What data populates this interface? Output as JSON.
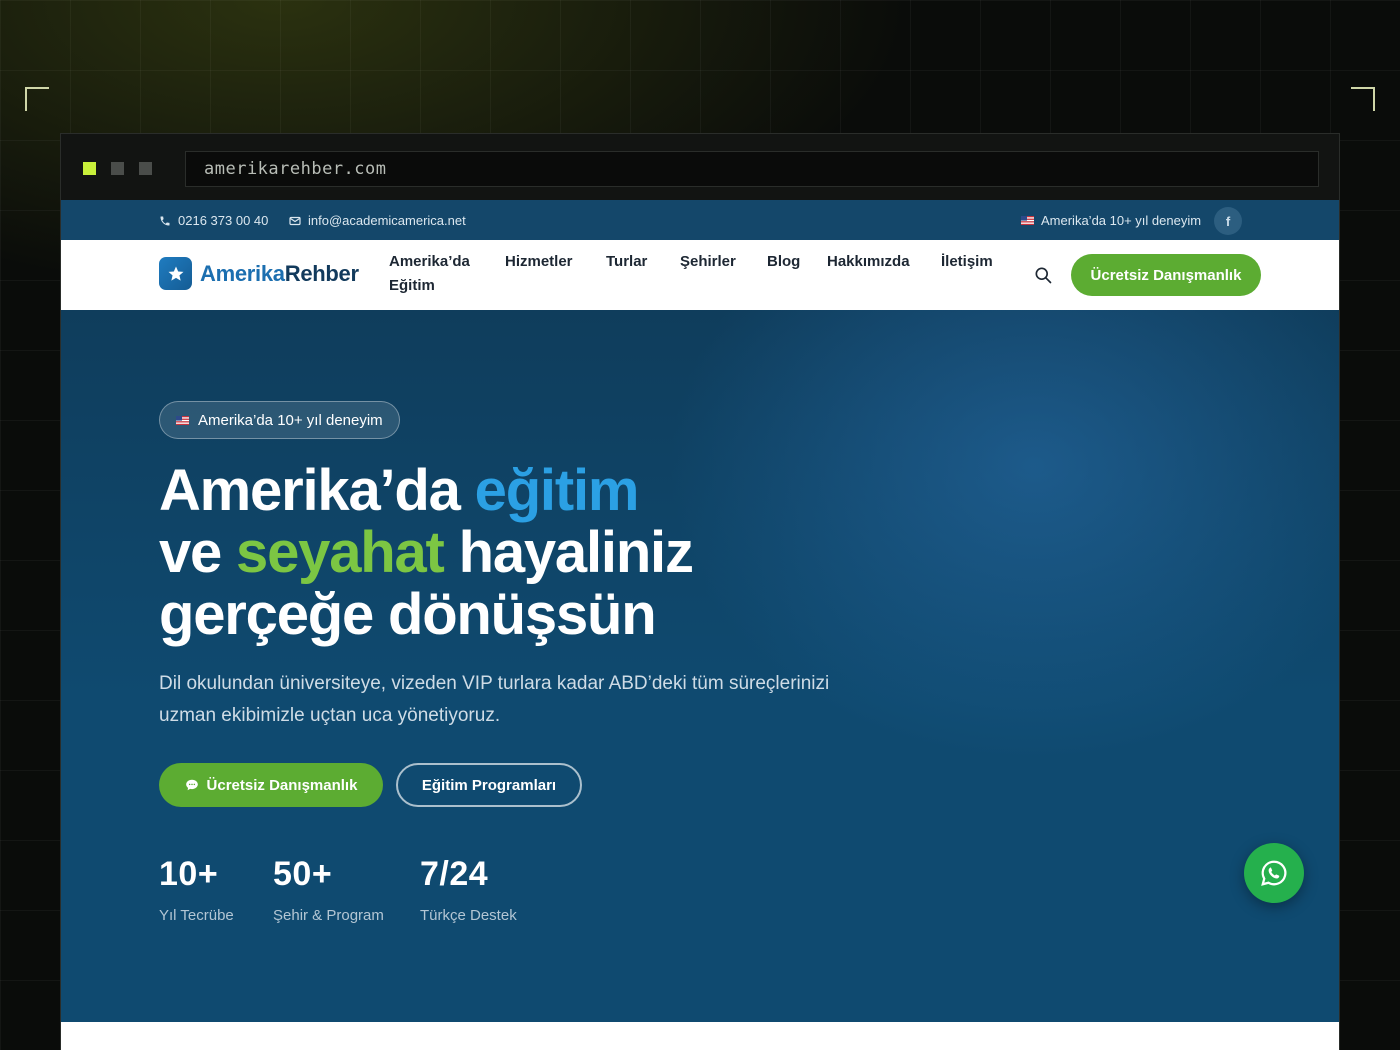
{
  "browser": {
    "url": "amerikarehber.com"
  },
  "topbar": {
    "phone": "0216 373 00 40",
    "email": "info@academicamerica.net",
    "experience": "Amerika’da 10+ yıl deneyim",
    "social_icon": "facebook-icon"
  },
  "brand": {
    "name_part1": "Amerika",
    "name_part2": "Rehber",
    "logo_icon": "star-icon"
  },
  "nav": {
    "items": [
      "Amerika’da",
      "Eğitim",
      "Hizmetler",
      "Turlar",
      "Şehirler",
      "Blog",
      "Hakkımızda",
      "İletişim"
    ],
    "cta": "Ücretsiz Danışmanlık"
  },
  "hero": {
    "badge": "Amerika’da 10+ yıl deneyim",
    "title_line1_a": "Amerika’da ",
    "title_line1_b": "eğitim",
    "title_line2_a": "ve ",
    "title_line2_b": "seyahat",
    "title_line2_c": " hayaliniz",
    "title_line3": "gerçeğe dönüşsün",
    "subtitle_line1": "Dil okulundan üniversiteye, vizeden VIP turlara kadar ABD’deki tüm süreçlerinizi",
    "subtitle_line2": "uzman ekibimizle uçtan uca yönetiyoruz.",
    "primary_button": "Ücretsiz Danışmanlık",
    "secondary_button": "Eğitim Programları",
    "stats": [
      {
        "value": "10+",
        "label": "Yıl Tecrübe"
      },
      {
        "value": "50+",
        "label": "Şehir & Program"
      },
      {
        "value": "7/24",
        "label": "Türkçe Destek"
      }
    ]
  },
  "colors": {
    "accent_green": "#5cac32",
    "accent_blue": "#2ba0e4",
    "topbar": "#14476a",
    "hero": "#0f4a70"
  }
}
